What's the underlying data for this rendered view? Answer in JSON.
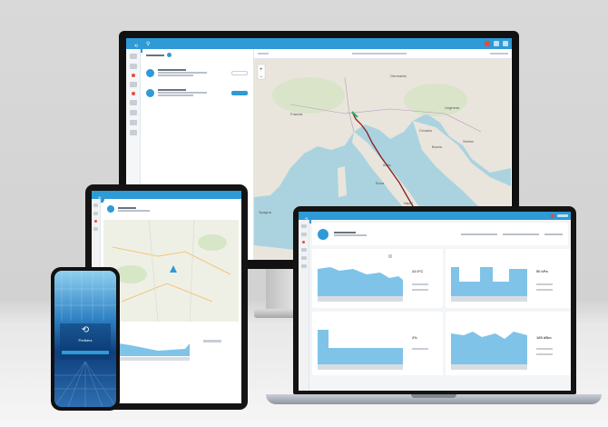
{
  "brand": {
    "name": "Pedbers"
  },
  "colors": {
    "accent": "#2e9ad6",
    "chart_fill": "#7fc3e8",
    "route": "#8a1d1d",
    "map_land": "#e9e5dc",
    "map_sea": "#aad3df"
  },
  "desktop": {
    "map_labels": [
      "Francia",
      "Italia",
      "Germania",
      "Ungheria",
      "Croazia",
      "Serbia",
      "Spagna",
      "Roma",
      "Napoli",
      "Bosnia"
    ],
    "zoom_plus": "+",
    "zoom_minus": "−"
  },
  "laptop": {
    "card_values": [
      "22.0°C",
      "50 kPa",
      "2%",
      "185 dBm"
    ]
  },
  "phone": {
    "brand": "Pedbers"
  }
}
